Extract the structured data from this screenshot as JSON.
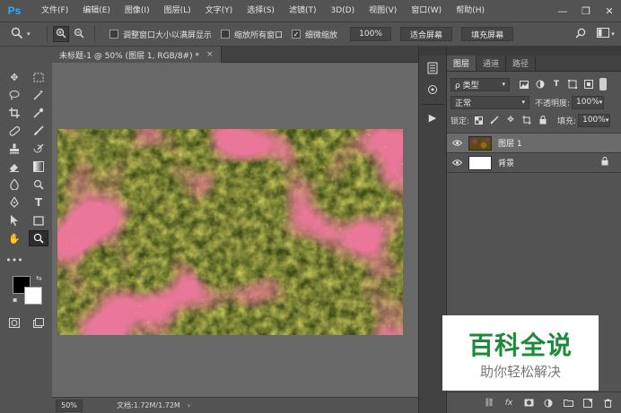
{
  "app": {
    "logo": "Ps"
  },
  "menu": [
    "文件(F)",
    "编辑(E)",
    "图像(I)",
    "图层(L)",
    "文字(Y)",
    "选择(S)",
    "滤镜(T)",
    "3D(D)",
    "视图(V)",
    "窗口(W)",
    "帮助(H)"
  ],
  "window_controls": {
    "minimize": "—",
    "restore": "❐",
    "close": "✕"
  },
  "options": {
    "tool_icon": "zoom-tool-icon",
    "checkbox_resize": {
      "label": "调整窗口大小以满屏显示",
      "checked": false
    },
    "checkbox_all": {
      "label": "缩放所有窗口",
      "checked": false
    },
    "checkbox_scrubby": {
      "label": "细微缩放",
      "checked": true
    },
    "zoom_pct": "100%",
    "fit_screen": "适合屏幕",
    "fill_screen": "填充屏幕"
  },
  "document": {
    "tab_title": "未标题-1 @ 50% (图层 1, RGB/8#) *",
    "tab_close": "×",
    "zoom": "50%",
    "doc_info": "文档:1.72M/1.72M",
    "status_arrow": "›"
  },
  "layers_panel": {
    "tabs": [
      "图层",
      "通道",
      "路径"
    ],
    "active_tab": 0,
    "filter_kind": "ρ 类型",
    "blend_mode": "正常",
    "opacity_label": "不透明度:",
    "opacity_value": "100%",
    "lock_label": "锁定:",
    "fill_label": "填充:",
    "fill_value": "100%",
    "layers": [
      {
        "name": "图层 1",
        "selected": true,
        "locked": false,
        "thumb": "texture"
      },
      {
        "name": "背景",
        "selected": false,
        "locked": true,
        "thumb": "white"
      }
    ],
    "footer_fx": "fx"
  },
  "watermark": {
    "title": "百科全说",
    "subtitle": "助你轻松解决"
  },
  "colors": {
    "foreground": "#000000",
    "background": "#ffffff",
    "watermark_green": "#1d8a3a"
  }
}
